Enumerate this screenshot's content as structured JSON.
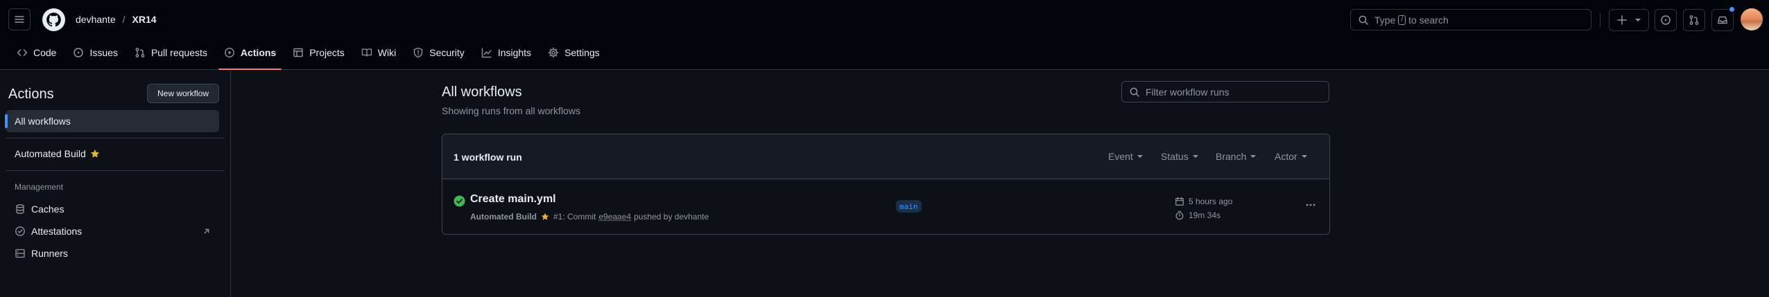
{
  "header": {
    "owner": "devhante",
    "separator": "/",
    "repo": "XR14",
    "search": {
      "pre": "Type",
      "key": "/",
      "post": "to search"
    }
  },
  "tabs": [
    {
      "label": "Code",
      "icon": "code-icon"
    },
    {
      "label": "Issues",
      "icon": "issue-opened-icon"
    },
    {
      "label": "Pull requests",
      "icon": "git-pull-request-icon"
    },
    {
      "label": "Actions",
      "icon": "play-icon",
      "selected": true
    },
    {
      "label": "Projects",
      "icon": "table-icon"
    },
    {
      "label": "Wiki",
      "icon": "book-icon"
    },
    {
      "label": "Security",
      "icon": "shield-icon"
    },
    {
      "label": "Insights",
      "icon": "graph-icon"
    },
    {
      "label": "Settings",
      "icon": "gear-icon"
    }
  ],
  "sidebar": {
    "title": "Actions",
    "new_workflow": "New workflow",
    "all_workflows": "All workflows",
    "workflow": "Automated Build",
    "management_heading": "Management",
    "management": [
      {
        "label": "Caches",
        "icon": "database-icon"
      },
      {
        "label": "Attestations",
        "icon": "verified-icon"
      },
      {
        "label": "Runners",
        "icon": "server-icon"
      }
    ]
  },
  "main": {
    "title": "All workflows",
    "subtitle": "Showing runs from all workflows",
    "filter_placeholder": "Filter workflow runs",
    "run_count": "1 workflow run",
    "filters": [
      "Event",
      "Status",
      "Branch",
      "Actor"
    ],
    "run": {
      "title": "Create main.yml",
      "workflow": "Automated Build",
      "meta_pre": "#1: Commit",
      "sha": "e9eaae4",
      "meta_post": "pushed by devhante",
      "branch": "main",
      "time_ago": "5 hours ago",
      "duration": "19m 34s",
      "status": "success"
    }
  },
  "colors": {
    "accent": "#f78166",
    "success": "#3fb950",
    "link": "#4493f8",
    "star": "#e3b341"
  }
}
